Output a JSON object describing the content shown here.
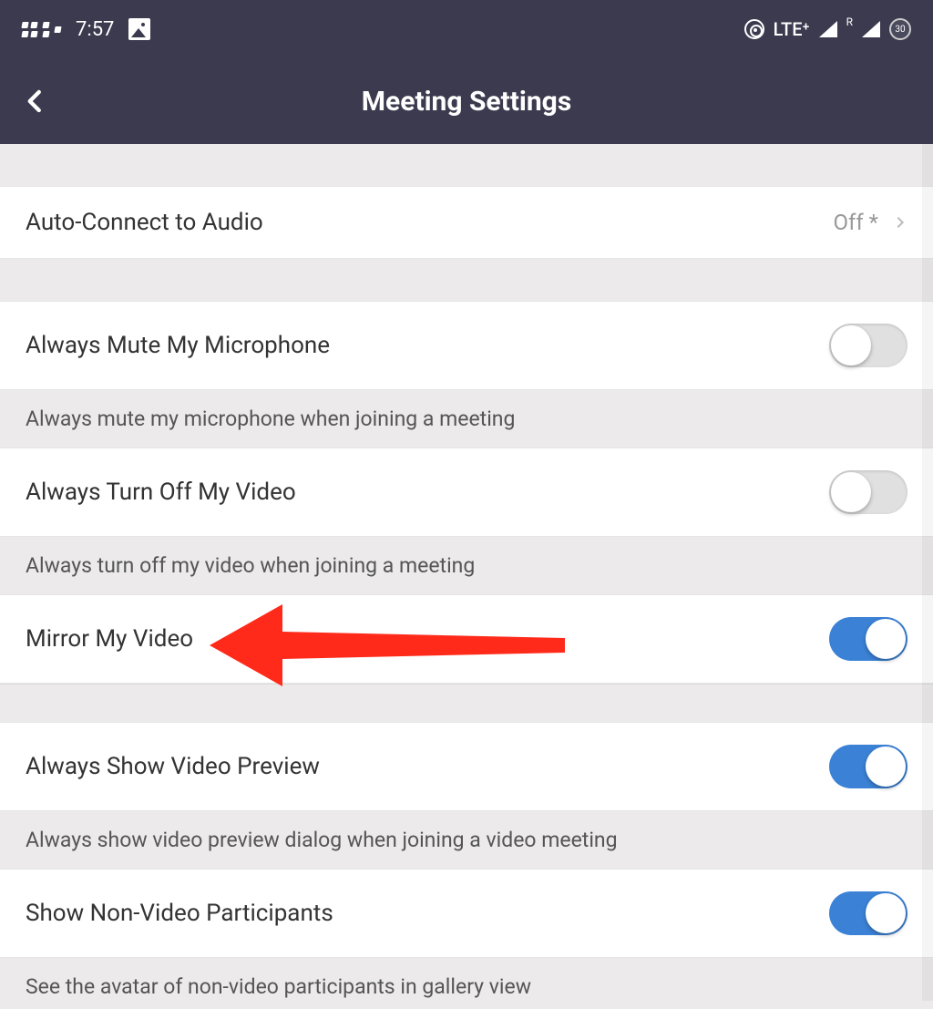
{
  "statusBar": {
    "time": "7:57",
    "network": "LTE⁺",
    "superscript": "R",
    "battery": "30"
  },
  "header": {
    "title": "Meeting Settings"
  },
  "rows": {
    "autoConnect": {
      "label": "Auto-Connect to Audio",
      "value": "Off *"
    },
    "muteMic": {
      "label": "Always Mute My Microphone",
      "desc": "Always mute my microphone when joining a meeting",
      "on": false
    },
    "turnOffVideo": {
      "label": "Always Turn Off My Video",
      "desc": "Always turn off my video when joining a meeting",
      "on": false
    },
    "mirrorVideo": {
      "label": "Mirror My Video",
      "on": true
    },
    "showPreview": {
      "label": "Always Show Video Preview",
      "desc": "Always show video preview dialog when joining a video meeting",
      "on": true
    },
    "nonVideo": {
      "label": "Show Non-Video Participants",
      "desc": "See the avatar of non-video participants in gallery view",
      "on": true
    }
  }
}
